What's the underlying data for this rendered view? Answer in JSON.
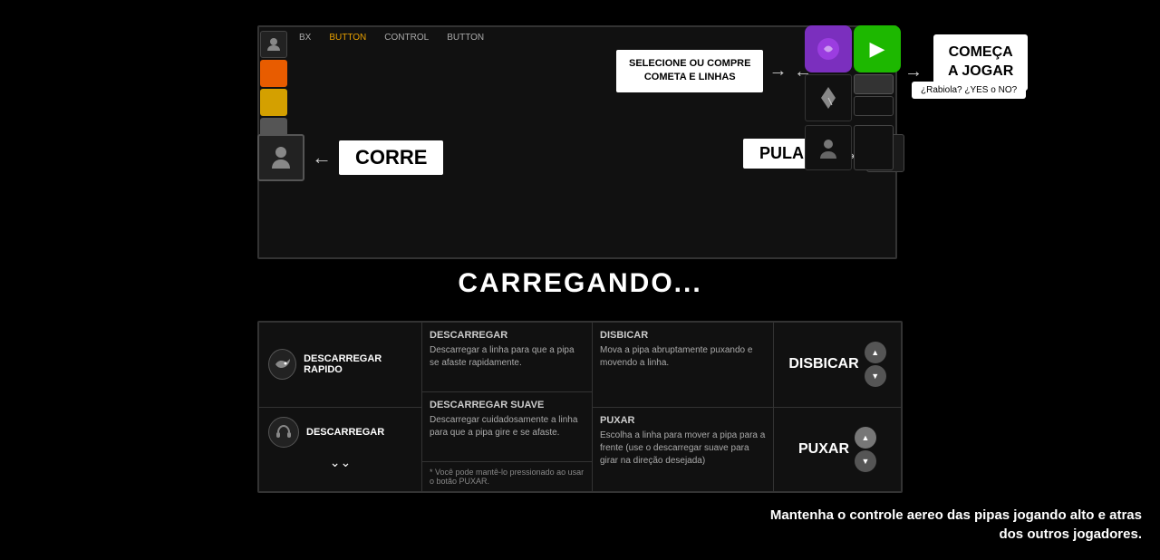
{
  "game": {
    "panel_bg": "#111",
    "nav_items": [
      {
        "label": "BX",
        "active": false
      },
      {
        "label": "BUTTON",
        "active": false
      },
      {
        "label": "CONTROL",
        "active": false
      },
      {
        "label": "BUTTON",
        "active": false
      }
    ]
  },
  "corre": {
    "label": "CORRE",
    "arrow": "←"
  },
  "pular": {
    "label": "PULAR",
    "arrow": "→"
  },
  "select_area": {
    "text_line1": "SELECIONE OU COMPRE",
    "text_line2": "COMETA E LINHAS",
    "arrow": "→"
  },
  "start_button": {
    "line1": "COMEÇA",
    "line2": "A JOGAR",
    "rabiola": "¿Rabiola? ¿YES o NO?"
  },
  "loading": {
    "text": "CARREGANDO..."
  },
  "info_panel": {
    "left_top": {
      "icon": "🐟",
      "label": "DESCARREGAR RAPIDO"
    },
    "left_bottom": {
      "icon": "🎧",
      "label": "DESCARREGAR",
      "chevron": "⌄⌄"
    },
    "center_top": {
      "title": "DESCARREGAR",
      "text": "Descarregar a linha para que a pipa se afaste rapidamente."
    },
    "center_bottom": {
      "title": "DESCARREGAR SUAVE",
      "text": "Descarregar cuidadosamente a linha para que a pipa gire e se afaste."
    },
    "note": "* Você pode mantê-lo pressionado ao usar o botão PUXAR.",
    "right_top": {
      "title": "DISBICAR",
      "text": "Mova a pipa abruptamente puxando e movendo a linha."
    },
    "right_bottom": {
      "title": "PUXAR",
      "text": "Escolha a linha para mover a pipa para a frente (use o descarregar suave para girar na direção desejada)"
    },
    "far_right_top": "DISBICAR",
    "far_right_bottom": "PUXAR",
    "scroll_up": "▲",
    "scroll_down": "▼"
  },
  "bottom_text": {
    "line1": "Mantenha o controle aereo das pipas jogando alto e atras",
    "line2": "dos outros jogadores."
  }
}
